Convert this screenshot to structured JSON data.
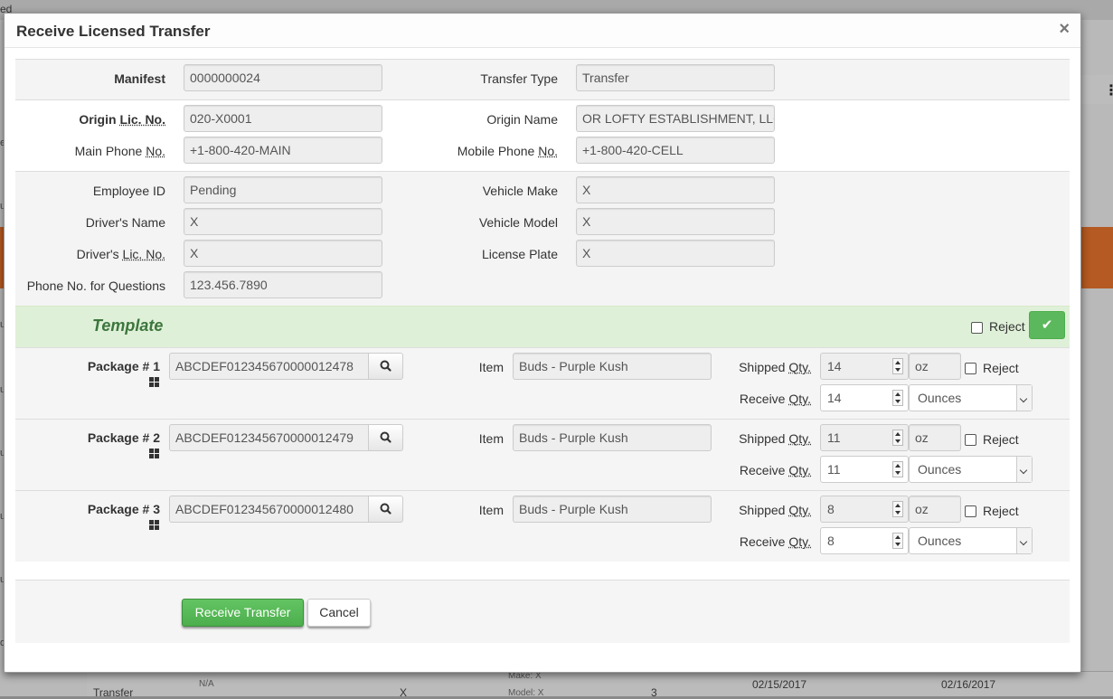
{
  "background": {
    "top_fragment": "ed",
    "left_fragments": [
      "e",
      "u",
      "u",
      "u",
      "u",
      "u",
      "u",
      "u",
      "d"
    ],
    "row": {
      "type": "Transfer",
      "na": "N/A",
      "x": "X",
      "make": "Make: X",
      "model": "Model: X",
      "count": "3",
      "date1": "02/15/2017",
      "date2": "02/16/2017"
    }
  },
  "modal": {
    "title": "Receive Licensed Transfer",
    "close": "×",
    "manifest": {
      "label": "Manifest",
      "value": "0000000024"
    },
    "transfer_type": {
      "label": "Transfer Type",
      "value": "Transfer"
    },
    "origin_lic": {
      "label_pre": "Origin ",
      "label_u": "Lic. No.",
      "value": "020-X0001"
    },
    "origin_name": {
      "label": "Origin Name",
      "value": "OR LOFTY ESTABLISHMENT, LLC"
    },
    "main_phone": {
      "label_pre": "Main Phone ",
      "label_u": "No.",
      "value": "+1-800-420-MAIN"
    },
    "mobile_phone": {
      "label_pre": "Mobile Phone ",
      "label_u": "No.",
      "value": "+1-800-420-CELL"
    },
    "employee_id": {
      "label": "Employee ID",
      "value": "Pending"
    },
    "vehicle_make": {
      "label": "Vehicle Make",
      "value": "X"
    },
    "driver_name": {
      "label": "Driver's Name",
      "value": "X"
    },
    "vehicle_model": {
      "label": "Vehicle Model",
      "value": "X"
    },
    "driver_lic": {
      "label_pre": "Driver's ",
      "label_u": "Lic. No.",
      "value": "X"
    },
    "license_plate": {
      "label": "License Plate",
      "value": "X"
    },
    "phone_questions": {
      "label": "Phone No. for Questions",
      "value": "123.456.7890"
    },
    "template": {
      "title": "Template",
      "reject": "Reject",
      "check": "✔"
    },
    "labels": {
      "item": "Item",
      "shipped_pre": "Shipped ",
      "receive_pre": "Receive ",
      "qty": "Qty.",
      "reject": "Reject"
    },
    "packages": [
      {
        "label": "Package # 1",
        "tag": "ABCDEF012345670000012478",
        "item": "Buds - Purple Kush",
        "shipped": "14",
        "shipped_unit": "oz",
        "receive": "14",
        "receive_unit": "Ounces"
      },
      {
        "label": "Package # 2",
        "tag": "ABCDEF012345670000012479",
        "item": "Buds - Purple Kush",
        "shipped": "11",
        "shipped_unit": "oz",
        "receive": "11",
        "receive_unit": "Ounces"
      },
      {
        "label": "Package # 3",
        "tag": "ABCDEF012345670000012480",
        "item": "Buds - Purple Kush",
        "shipped": "8",
        "shipped_unit": "oz",
        "receive": "8",
        "receive_unit": "Ounces"
      }
    ],
    "buttons": {
      "receive": "Receive Transfer",
      "cancel": "Cancel"
    }
  }
}
